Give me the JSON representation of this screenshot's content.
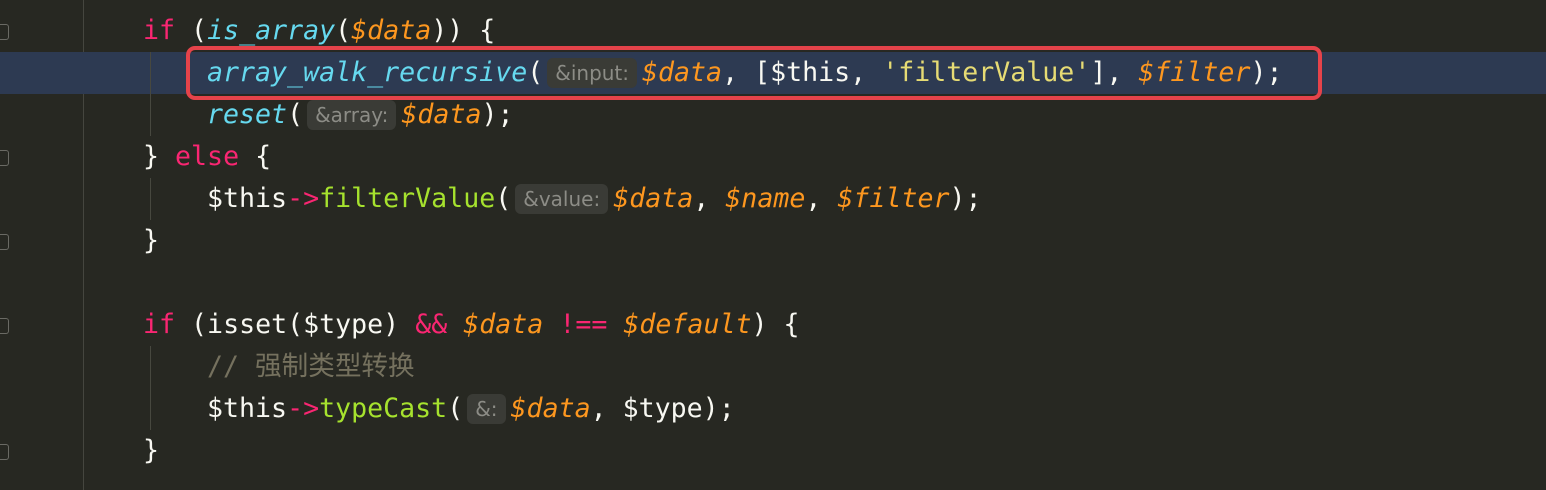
{
  "editor": {
    "theme_colors": {
      "background": "#272822",
      "highlight": "#2d3a52",
      "keyword": "#f92672",
      "function": "#66d9ef",
      "variable": "#fd971f",
      "string": "#e6db74",
      "method": "#a6e22e",
      "comment": "#75715e",
      "annotation_box": "#e5434a"
    },
    "highlighted_line": 1,
    "lines": [
      {
        "indent": 1,
        "tokens": [
          {
            "t": "kw",
            "v": "if"
          },
          {
            "t": "pl",
            "v": " ("
          },
          {
            "t": "fn",
            "v": "is_array"
          },
          {
            "t": "pl",
            "v": "("
          },
          {
            "t": "var",
            "v": "$data"
          },
          {
            "t": "pl",
            "v": ")) {"
          }
        ]
      },
      {
        "indent": 2,
        "tokens": [
          {
            "t": "fn",
            "v": "array_walk_recursive"
          },
          {
            "t": "pl",
            "v": "("
          },
          {
            "t": "hint",
            "v": "&input:"
          },
          {
            "t": "var",
            "v": "$data"
          },
          {
            "t": "pl",
            "v": ", [$this, "
          },
          {
            "t": "str",
            "v": "'filterValue'"
          },
          {
            "t": "pl",
            "v": "], "
          },
          {
            "t": "var",
            "v": "$filter"
          },
          {
            "t": "pl",
            "v": ");"
          }
        ]
      },
      {
        "indent": 2,
        "tokens": [
          {
            "t": "fn",
            "v": "reset"
          },
          {
            "t": "pl",
            "v": "("
          },
          {
            "t": "hint",
            "v": "&array:"
          },
          {
            "t": "var",
            "v": "$data"
          },
          {
            "t": "pl",
            "v": ");"
          }
        ]
      },
      {
        "indent": 1,
        "tokens": [
          {
            "t": "pl",
            "v": "} "
          },
          {
            "t": "kw",
            "v": "else"
          },
          {
            "t": "pl",
            "v": " {"
          }
        ]
      },
      {
        "indent": 2,
        "tokens": [
          {
            "t": "pl",
            "v": "$this"
          },
          {
            "t": "op",
            "v": "->"
          },
          {
            "t": "mth",
            "v": "filterValue"
          },
          {
            "t": "pl",
            "v": "("
          },
          {
            "t": "hint",
            "v": "&value:"
          },
          {
            "t": "var",
            "v": "$data"
          },
          {
            "t": "pl",
            "v": ", "
          },
          {
            "t": "var",
            "v": "$name"
          },
          {
            "t": "pl",
            "v": ", "
          },
          {
            "t": "var",
            "v": "$filter"
          },
          {
            "t": "pl",
            "v": ");"
          }
        ]
      },
      {
        "indent": 1,
        "tokens": [
          {
            "t": "pl",
            "v": "}"
          }
        ]
      },
      {
        "indent": 1,
        "tokens": []
      },
      {
        "indent": 1,
        "tokens": [
          {
            "t": "kw",
            "v": "if"
          },
          {
            "t": "pl",
            "v": " (isset($type) "
          },
          {
            "t": "op",
            "v": "&&"
          },
          {
            "t": "pl",
            "v": " "
          },
          {
            "t": "var",
            "v": "$data"
          },
          {
            "t": "pl",
            "v": " "
          },
          {
            "t": "op",
            "v": "!=="
          },
          {
            "t": "pl",
            "v": " "
          },
          {
            "t": "var",
            "v": "$default"
          },
          {
            "t": "pl",
            "v": ") {"
          }
        ]
      },
      {
        "indent": 2,
        "tokens": [
          {
            "t": "cm",
            "v": "// 强制类型转换"
          }
        ]
      },
      {
        "indent": 2,
        "tokens": [
          {
            "t": "pl",
            "v": "$this"
          },
          {
            "t": "op",
            "v": "->"
          },
          {
            "t": "mth",
            "v": "typeCast"
          },
          {
            "t": "pl",
            "v": "("
          },
          {
            "t": "hint",
            "v": "&:"
          },
          {
            "t": "var",
            "v": "$data"
          },
          {
            "t": "pl",
            "v": ", $type);"
          }
        ]
      },
      {
        "indent": 1,
        "tokens": [
          {
            "t": "pl",
            "v": "}"
          }
        ]
      }
    ]
  }
}
